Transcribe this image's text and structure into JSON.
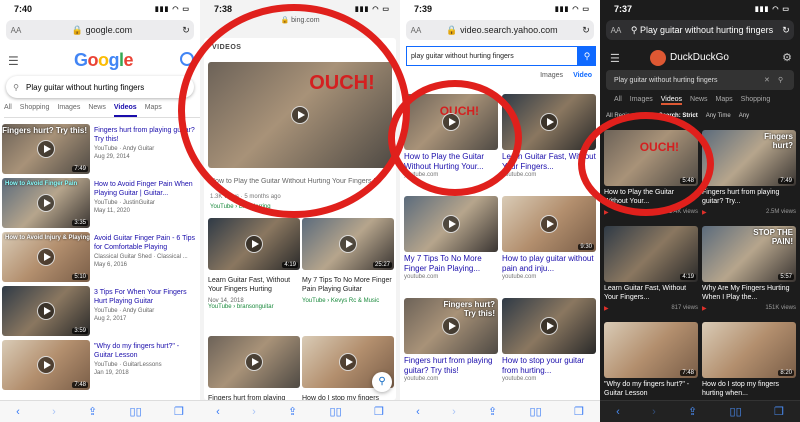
{
  "panels": {
    "google": {
      "time": "7:40",
      "url": "google.com",
      "logo": "Google",
      "query": "Play guitar without hurting fingers",
      "tabs": [
        "All",
        "Shopping",
        "Images",
        "News",
        "Videos",
        "Maps"
      ],
      "active_tab": "Videos",
      "results": [
        {
          "title": "Fingers hurt from playing guitar? Try this!",
          "meta1": "YouTube · Andy Guitar",
          "meta2": "Aug 29, 2014",
          "duration": "7:49",
          "caption": "Fingers hurt? Try this!"
        },
        {
          "title": "How to Avoid Finger Pain When Playing Guitar | Guitar...",
          "meta1": "YouTube · JustinGuitar",
          "meta2": "May 11, 2020",
          "duration": "3:35",
          "caption": "How to Avoid Finger Pain"
        },
        {
          "title": "Avoid Guitar Finger Pain - 6 Tips for Comfortable Playing",
          "meta1": "Classical Guitar Shed · Classical ...",
          "meta2": "May 6, 2016",
          "duration": "5:10",
          "caption": "How to Avoid Injury & Playing"
        },
        {
          "title": "3 Tips For When Your Fingers Hurt Playing Guitar",
          "meta1": "YouTube · Andy Guitar",
          "meta2": "Aug 2, 2017",
          "duration": "3:59",
          "caption": ""
        },
        {
          "title": "\"Why do my fingers hurt?\" - Guitar Lesson",
          "meta1": "YouTube · GuitarLessons",
          "meta2": "Jan 19, 2018",
          "duration": "7:48",
          "caption": ""
        }
      ]
    },
    "bing": {
      "time": "7:38",
      "url": "bing.com",
      "section": "VIDEOS",
      "hero": {
        "title": "How to Play the Guitar Without Hurting Your Fingers | 5",
        "meta": "1.3K views · 5 months ago",
        "source": "YouTube › Eric Herring",
        "overlay": "OUCH!"
      },
      "cards": [
        {
          "title": "Learn Guitar Fast, Without Your Fingers Hurting",
          "meta": "Nov 14, 2018",
          "source": "YouTube › bransonguitar",
          "duration": "4:19"
        },
        {
          "title": "My 7 Tips To No More Finger Pain Playing Guitar",
          "meta": "",
          "source": "YouTube › Kevys Rc & Music",
          "duration": "25:27"
        },
        {
          "title": "Fingers hurt from playing guitar? Try this!",
          "meta": "",
          "source": "",
          "duration": ""
        },
        {
          "title": "How do I stop my fingers hurting when playing guitar?",
          "meta": "",
          "source": "",
          "duration": ""
        }
      ]
    },
    "yahoo": {
      "time": "7:39",
      "url": "video.search.yahoo.com",
      "query": "play guitar without hurting fingers",
      "tabs": [
        "Images",
        "Video"
      ],
      "active_tab": "Video",
      "cards": [
        {
          "title": "How to Play the Guitar Without Hurting Your...",
          "source": "youtube.com",
          "duration": ""
        },
        {
          "title": "Learn Guitar Fast, Without Your Fingers...",
          "source": "youtube.com",
          "duration": ""
        },
        {
          "title": "My 7 Tips To No More Finger Pain Playing...",
          "source": "youtube.com",
          "duration": ""
        },
        {
          "title": "How to play guitar without pain and inju...",
          "source": "youtube.com",
          "duration": "9:30"
        },
        {
          "title": "Fingers hurt from playing guitar? Try this!",
          "source": "youtube.com",
          "duration": ""
        },
        {
          "title": "How to stop your guitar from hurting...",
          "source": "youtube.com",
          "duration": ""
        }
      ]
    },
    "ddg": {
      "time": "7:37",
      "url": "Play guitar without hurting fingers",
      "brand": "DuckDuckGo",
      "query": "Play guitar without hurting fingers",
      "tabs": [
        "All",
        "Images",
        "Videos",
        "News",
        "Maps",
        "Shopping"
      ],
      "active_tab": "Videos",
      "filters": [
        "All Regions",
        "Safe Search: Strict",
        "Any Time",
        "Any"
      ],
      "cards": [
        {
          "title": "How to Play the Guitar Without Your...",
          "views": "1.4K views",
          "duration": "5:48"
        },
        {
          "title": "Fingers hurt from playing guitar? Try...",
          "views": "2.5M views",
          "duration": "7:49"
        },
        {
          "title": "Learn Guitar Fast, Without Your Fingers...",
          "views": "817 views",
          "duration": "4:19"
        },
        {
          "title": "Why Are My Fingers Hurting When I Play the...",
          "views": "151K views",
          "duration": "5:57"
        },
        {
          "title": "\"Why do my fingers hurt?\" - Guitar Lesson",
          "views": "",
          "duration": "7:48"
        },
        {
          "title": "How do I stop my fingers hurting when...",
          "views": "",
          "duration": "8:20"
        }
      ]
    }
  },
  "colors": {
    "highlight_ring": "#e0201c",
    "google_link": "#1a0dab",
    "ddg_orange": "#de5833",
    "yahoo_blue": "#0f69ff"
  }
}
